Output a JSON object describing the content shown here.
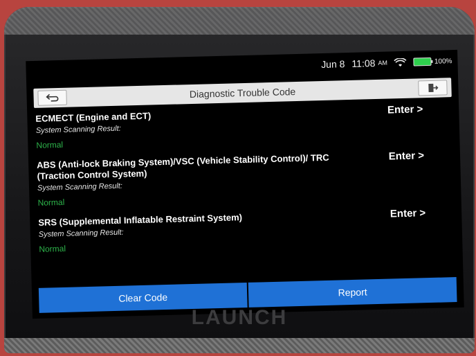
{
  "status_bar": {
    "date": "Jun 8",
    "time": "11:08",
    "ampm": "AM",
    "battery": "100%"
  },
  "title_bar": {
    "title": "Diagnostic Trouble Code"
  },
  "systems": [
    {
      "name": "ECMECT (Engine and ECT)",
      "result_label": "System Scanning Result:",
      "result": "Normal",
      "action": "Enter >"
    },
    {
      "name": "ABS (Anti-lock Braking System)/VSC (Vehicle Stability Control)/ TRC (Traction Control System)",
      "result_label": "System Scanning Result:",
      "result": "Normal",
      "action": "Enter >"
    },
    {
      "name": "SRS (Supplemental Inflatable Restraint System)",
      "result_label": "System Scanning Result:",
      "result": "Normal",
      "action": "Enter >"
    }
  ],
  "buttons": {
    "clear_code": "Clear Code",
    "report": "Report"
  },
  "device": {
    "brand": "LAUNCH"
  },
  "colors": {
    "normal_status": "#2db34a",
    "button_blue": "#1f71d6",
    "battery_green": "#2ed04d"
  }
}
